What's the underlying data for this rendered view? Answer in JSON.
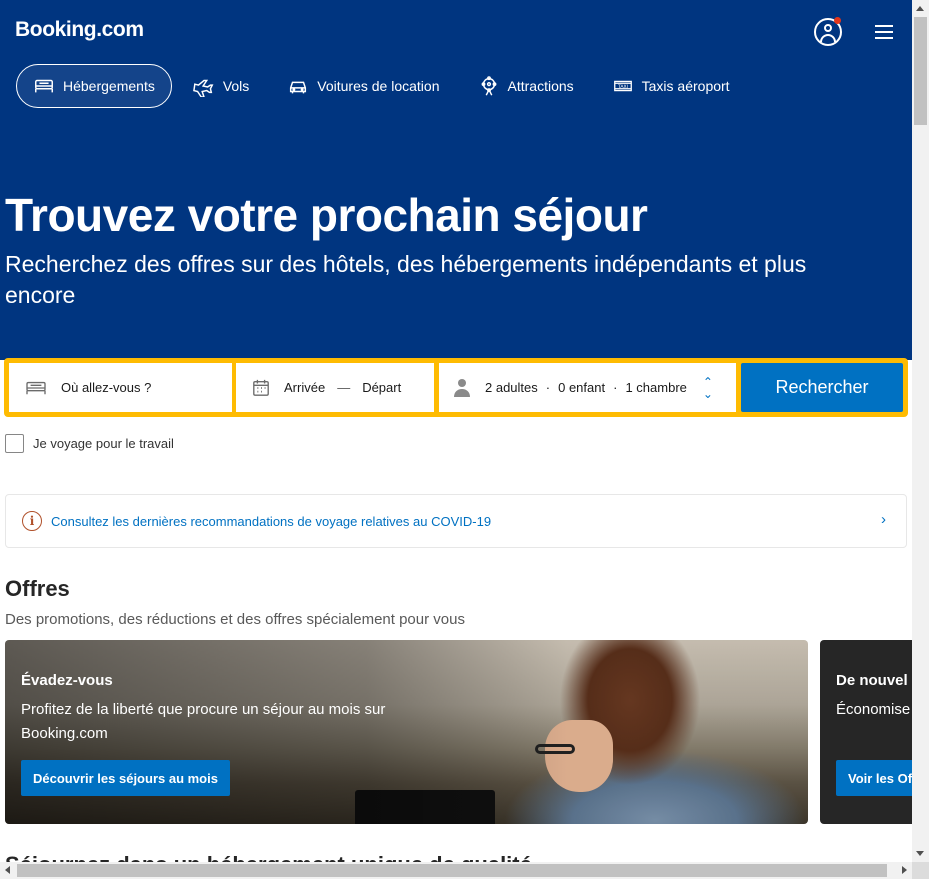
{
  "header": {
    "logo": "Booking.com",
    "user_icon": "user-account-icon",
    "menu_icon": "hamburger-menu-icon"
  },
  "nav": {
    "items": [
      {
        "label": "Hébergements",
        "icon": "bed-icon",
        "active": true
      },
      {
        "label": "Vols",
        "icon": "plane-icon",
        "active": false
      },
      {
        "label": "Voitures de location",
        "icon": "car-icon",
        "active": false
      },
      {
        "label": "Attractions",
        "icon": "ferris-wheel-icon",
        "active": false
      },
      {
        "label": "Taxis aéroport",
        "icon": "taxi-icon",
        "active": false
      }
    ]
  },
  "hero": {
    "title": "Trouvez votre prochain séjour",
    "subtitle": "Recherchez des offres sur des hôtels, des hébergements indépendants et plus encore"
  },
  "search": {
    "destination_placeholder": "Où allez-vous ?",
    "checkin_label": "Arrivée",
    "dash": "—",
    "checkout_label": "Départ",
    "adults": "2 adultes",
    "children": "0 enfant",
    "rooms": "1 chambre",
    "separator": "·",
    "button_label": "Rechercher"
  },
  "work_trip": {
    "label": "Je voyage pour le travail",
    "checked": false
  },
  "covid_banner": {
    "text": "Consultez les dernières recommandations de voyage relatives au COVID-19"
  },
  "offers": {
    "heading": "Offres",
    "subheading": "Des promotions, des réductions et des offres spécialement pour vous",
    "cards": [
      {
        "title": "Évadez-vous",
        "text": "Profitez de la liberté que procure un séjour au mois sur Booking.com",
        "button": "Découvrir les séjours au mois"
      },
      {
        "title": "De nouvel",
        "text": "Économise effectués a",
        "button": "Voir les Of"
      }
    ]
  },
  "next_section": {
    "heading": "Séjournez dans un hébergement unique de qualité"
  },
  "colors": {
    "brand_blue": "#003580",
    "action_blue": "#0071c2",
    "search_yellow": "#febb02"
  }
}
